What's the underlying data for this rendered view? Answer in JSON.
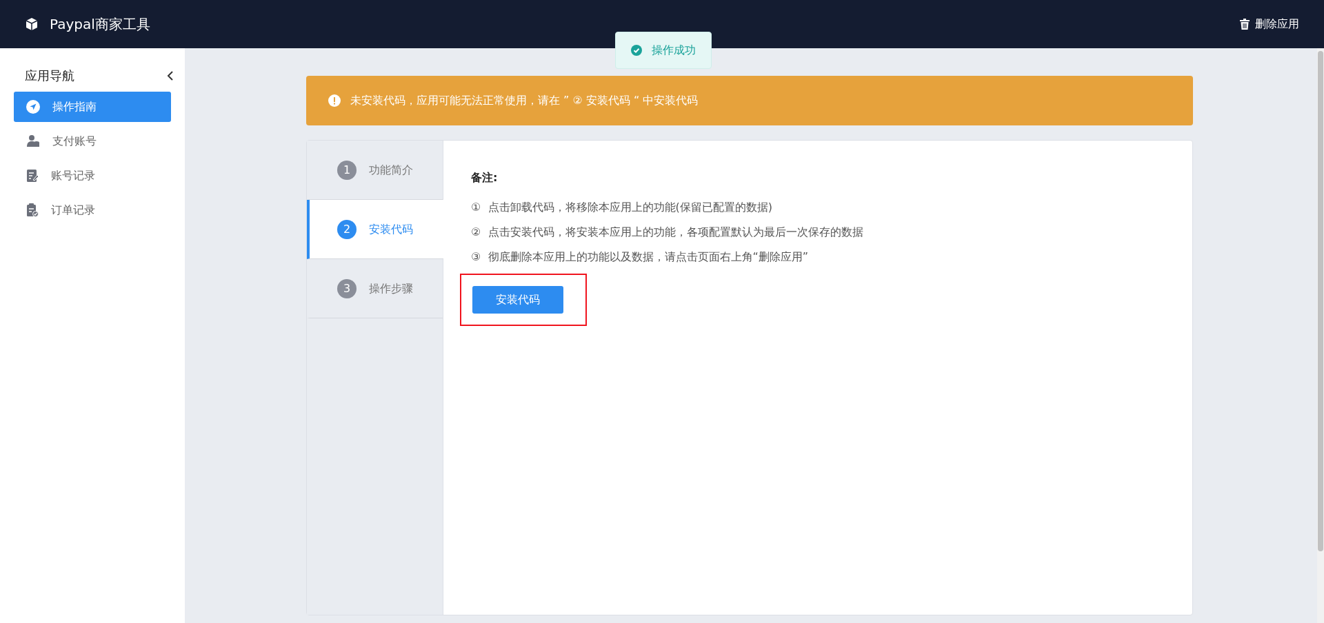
{
  "header": {
    "title": "Paypal商家工具",
    "action": "删除应用"
  },
  "toast": {
    "text": "操作成功"
  },
  "sidebar": {
    "title": "应用导航",
    "items": [
      {
        "label": "操作指南",
        "selected": true
      },
      {
        "label": "支付账号",
        "selected": false
      },
      {
        "label": "账号记录",
        "selected": false
      },
      {
        "label": "订单记录",
        "selected": false
      }
    ]
  },
  "alert": {
    "text": "未安装代码，应用可能无法正常使用，请在 ” ② 安装代码 “ 中安装代码"
  },
  "steps": [
    {
      "number": "1",
      "label": "功能简介",
      "selected": false
    },
    {
      "number": "2",
      "label": "安装代码",
      "selected": true
    },
    {
      "number": "3",
      "label": "操作步骤",
      "selected": false
    }
  ],
  "content": {
    "heading": "备注:",
    "notes": [
      "①  点击卸载代码，将移除本应用上的功能(保留已配置的数据)",
      "②  点击安装代码，将安装本应用上的功能，各项配置默认为最后一次保存的数据",
      "③  彻底删除本应用上的功能以及数据，请点击页面右上角“删除应用”"
    ],
    "button": "安装代码",
    "highlighted": true
  }
}
